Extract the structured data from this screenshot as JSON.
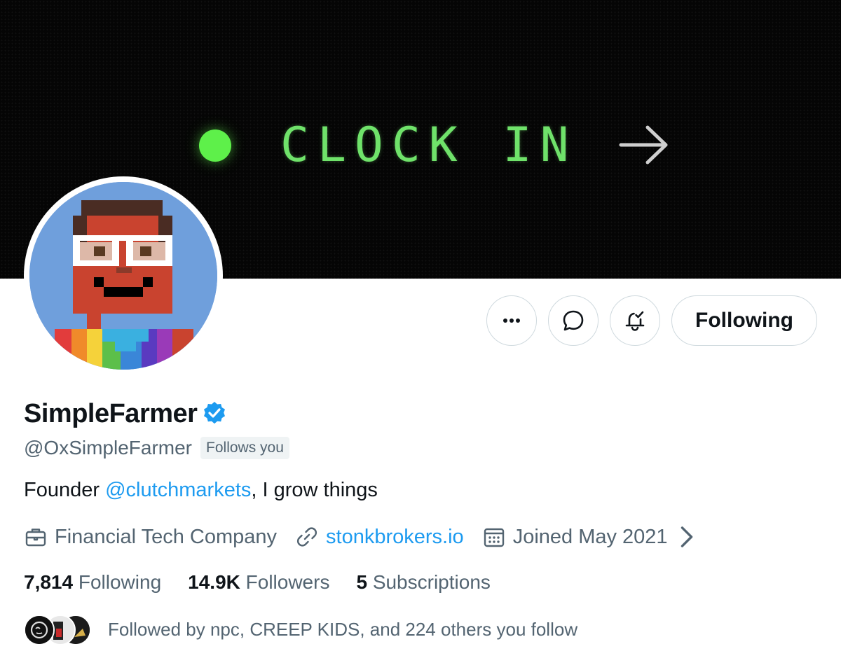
{
  "banner": {
    "text": "CLOCK IN",
    "accent_color": "#6fe26a",
    "dot_color": "#5ef04a",
    "arrow_icon": "arrow-right-icon"
  },
  "actions": {
    "more_icon": "more-dots-icon",
    "message_icon": "message-bubble-icon",
    "notifications_icon": "bell-check-icon",
    "following_label": "Following"
  },
  "profile": {
    "display_name": "SimpleFarmer",
    "verified_icon": "verified-badge-icon",
    "handle": "@OxSimpleFarmer",
    "follows_you": "Follows you",
    "bio_prefix": "Founder ",
    "bio_mention": "@clutchmarkets",
    "bio_suffix": ", I grow things",
    "category": "Financial Tech Company",
    "website": "stonkbrokers.io",
    "joined": "Joined May 2021"
  },
  "stats": {
    "following_count": "7,814",
    "following_label": "Following",
    "followers_count": "14.9K",
    "followers_label": "Followers",
    "subscriptions_count": "5",
    "subscriptions_label": "Subscriptions"
  },
  "followed_by": {
    "text": "Followed by npc, CREEP KIDS, and 224 others you follow"
  },
  "colors": {
    "link": "#1d9bf0",
    "secondary_text": "#536471",
    "primary_text": "#0f1419",
    "border": "#cfd9de"
  }
}
